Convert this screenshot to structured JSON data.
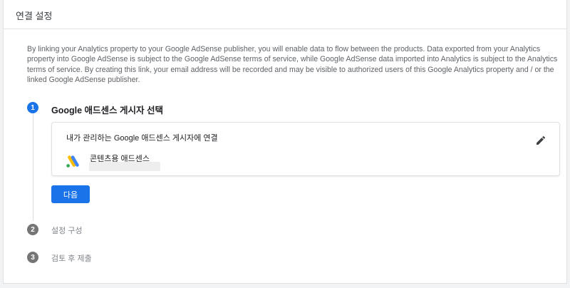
{
  "header": {
    "title": "연결 설정"
  },
  "description": "By linking your Analytics property to your Google AdSense publisher, you will enable data to flow between the products. Data exported from your Analytics property into Google AdSense is subject to the Google AdSense terms of service, while Google AdSense data imported into Analytics is subject to the Analytics terms of service. By creating this link, your email address will be recorded and may be visible to authorized users of this Google Analytics property and / or the linked Google AdSense publisher.",
  "steps": [
    {
      "number": "1",
      "label": "Google 애드센스 게시자 선택"
    },
    {
      "number": "2",
      "label": "설정 구성"
    },
    {
      "number": "3",
      "label": "검토 후 제출"
    }
  ],
  "card": {
    "title": "내가 관리하는 Google 애드센스 게시자에 연결",
    "account_name": "콘텐츠용 애드센스",
    "logo_icon": "adsense-logo",
    "edit_icon": "pencil-icon"
  },
  "next_button": {
    "label": "다음"
  },
  "colors": {
    "accent": "#1a73e8",
    "inactive_step": "#757575",
    "logo_yellow": "#fbbc04",
    "logo_blue": "#4285f4",
    "logo_green": "#34a853"
  }
}
